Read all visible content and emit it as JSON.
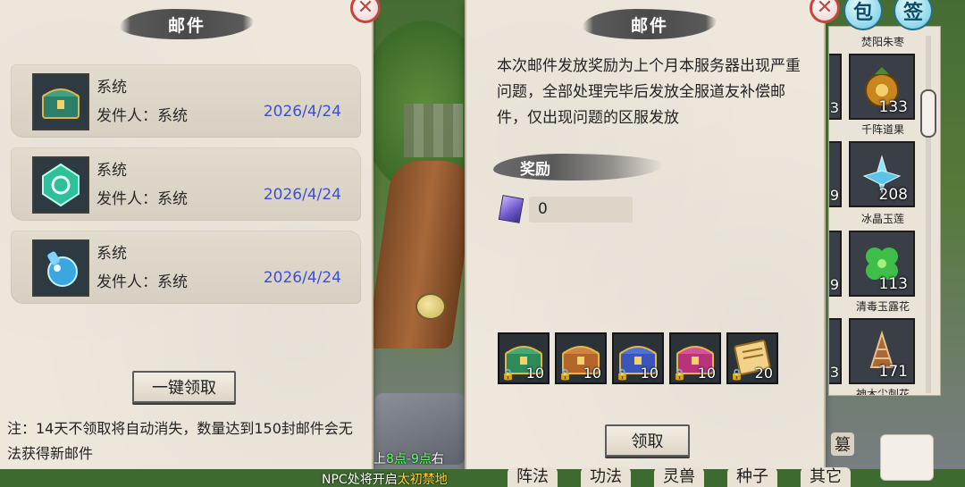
{
  "left_panel": {
    "title": "邮件",
    "mails": [
      {
        "sender": "系统",
        "from_label": "发件人：系统",
        "date": "2026/4/24",
        "icon": "treasure-chest-icon"
      },
      {
        "sender": "系统",
        "from_label": "发件人：系统",
        "date": "2026/4/24",
        "icon": "jade-crystal-icon"
      },
      {
        "sender": "系统",
        "from_label": "发件人：系统",
        "date": "2026/4/24",
        "icon": "blue-potion-icon"
      }
    ],
    "claim_all_label": "一键领取",
    "note": "注：14天不领取将自动消失，数量达到150封邮件会无法获得新邮件"
  },
  "right_panel": {
    "title": "邮件",
    "body": "本次邮件发放奖励为上个月本服务器出现严重问题，全部处理完毕后发放全服道友补偿邮件，仅出现问题的区服发放",
    "reward_label": "奖励",
    "currency_value": "0",
    "attachments": [
      {
        "icon": "green-chest-icon",
        "qty": "10",
        "color": "#2f8a5a"
      },
      {
        "icon": "orange-chest-icon",
        "qty": "10",
        "color": "#b4662a"
      },
      {
        "icon": "blue-chest-icon",
        "qty": "10",
        "color": "#3b56b8"
      },
      {
        "icon": "pink-chest-icon",
        "qty": "10",
        "color": "#b8337a"
      },
      {
        "icon": "scroll-icon",
        "qty": "20",
        "color": "#d9a53a"
      }
    ],
    "claim_label": "领取"
  },
  "inventory": {
    "items": [
      {
        "name": "焚阳朱枣",
        "qty": "133",
        "icon": "golden-fruit-icon",
        "partial": "3"
      },
      {
        "name": "千阵道果",
        "qty": "208",
        "icon": "lotus-crystal-icon",
        "partial": "9"
      },
      {
        "name": "冰晶玉莲",
        "qty": "113",
        "icon": "clover-icon",
        "partial": "9"
      },
      {
        "name": "清毒玉露花",
        "qty": "171",
        "icon": "conch-shell-icon",
        "partial": "3"
      }
    ],
    "cut_label": "神木尘刺花"
  },
  "top_buttons": {
    "bag": "包",
    "sign": "签"
  },
  "bottom": {
    "marquee_top_a": "上",
    "marquee_top_hl": "8点-9点",
    "marquee_top_b": "右",
    "marquee_a": "NPC处将开启",
    "marquee_hl": "太初禁地",
    "tabs": [
      "阵法",
      "功法",
      "灵兽",
      "种子",
      "其它"
    ],
    "side_label": "篡"
  }
}
